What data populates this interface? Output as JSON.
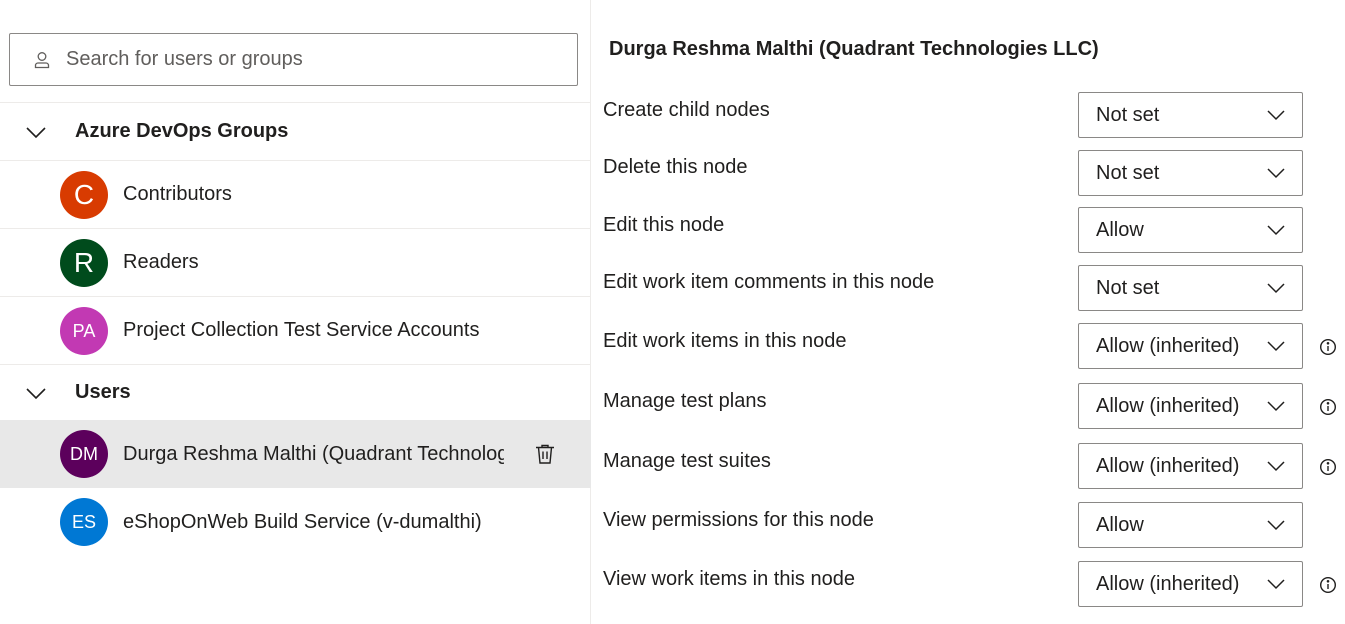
{
  "search": {
    "placeholder": "Search for users or groups"
  },
  "groups": [
    {
      "label": "Azure DevOps Groups",
      "items": [
        {
          "initials": "C",
          "name": "Contributors",
          "color": "#d83b01"
        },
        {
          "initials": "R",
          "name": "Readers",
          "color": "#004b1c"
        },
        {
          "initials": "PA",
          "name": "Project Collection Test Service Accounts",
          "color": "#c239b3"
        }
      ]
    },
    {
      "label": "Users",
      "items": [
        {
          "initials": "DM",
          "name": "Durga Reshma Malthi (Quadrant Technologies LLC)",
          "color": "#5c005c",
          "selected": true
        },
        {
          "initials": "ES",
          "name": "eShopOnWeb Build Service (v-dumalthi)",
          "color": "#0078d4"
        }
      ]
    }
  ],
  "detail": {
    "title": "Durga Reshma Malthi (Quadrant Technologies LLC)",
    "permissions": [
      {
        "label": "Create child nodes",
        "value": "Not set",
        "info": false
      },
      {
        "label": "Delete this node",
        "value": "Not set",
        "info": false
      },
      {
        "label": "Edit this node",
        "value": "Allow",
        "info": false
      },
      {
        "label": "Edit work item comments in this node",
        "value": "Not set",
        "info": false
      },
      {
        "label": "Edit work items in this node",
        "value": "Allow (inherited)",
        "info": true
      },
      {
        "label": "Manage test plans",
        "value": "Allow (inherited)",
        "info": true
      },
      {
        "label": "Manage test suites",
        "value": "Allow (inherited)",
        "info": true
      },
      {
        "label": "View permissions for this node",
        "value": "Allow",
        "info": false
      },
      {
        "label": "View work items in this node",
        "value": "Allow (inherited)",
        "info": true
      }
    ]
  }
}
